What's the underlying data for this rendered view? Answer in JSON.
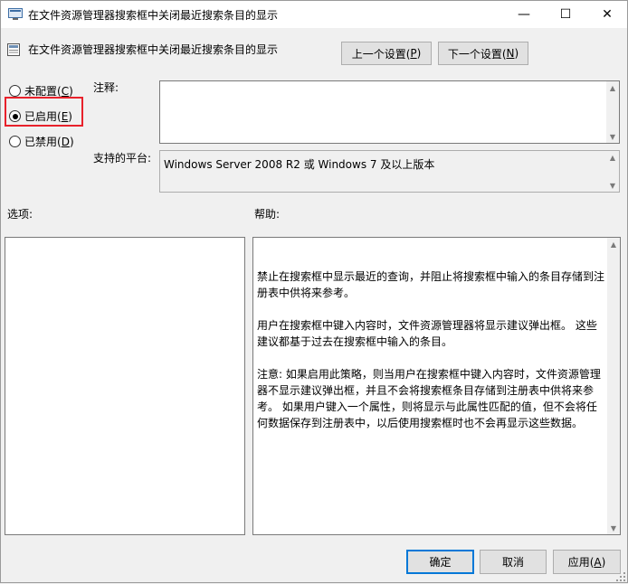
{
  "window": {
    "title": "在文件资源管理器搜索框中关闭最近搜索条目的显示",
    "minimize_glyph": "—",
    "maximize_glyph": "☐",
    "close_glyph": "✕"
  },
  "header": {
    "policy_name": "在文件资源管理器搜索框中关闭最近搜索条目的显示",
    "prev_button": {
      "text": "上一个设置(",
      "key": "P",
      "end": ")"
    },
    "next_button": {
      "text": "下一个设置(",
      "key": "N",
      "end": ")"
    }
  },
  "state": {
    "options": [
      {
        "text": "未配置(",
        "key": "C",
        "end": ")",
        "checked": false
      },
      {
        "text": "已启用(",
        "key": "E",
        "end": ")",
        "checked": true
      },
      {
        "text": "已禁用(",
        "key": "D",
        "end": ")",
        "checked": false
      }
    ]
  },
  "comment": {
    "label": "注释:",
    "value": ""
  },
  "platform": {
    "label": "支持的平台:",
    "value": "Windows Server 2008 R2 或 Windows 7 及以上版本"
  },
  "options_section": {
    "label": "选项:"
  },
  "help_section": {
    "label": "帮助:",
    "paragraphs": [
      "禁止在搜索框中显示最近的查询，并阻止将搜索框中输入的条目存储到注册表中供将来参考。",
      "用户在搜索框中键入内容时，文件资源管理器将显示建议弹出框。 这些建议都基于过去在搜索框中输入的条目。",
      "注意: 如果启用此策略，则当用户在搜索框中键入内容时，文件资源管理器不显示建议弹出框，并且不会将搜索框条目存储到注册表中供将来参考。 如果用户键入一个属性，则将显示与此属性匹配的值，但不会将任何数据保存到注册表中，以后使用搜索框时也不会再显示这些数据。"
    ]
  },
  "footer": {
    "ok": "确定",
    "cancel": "取消",
    "apply": {
      "text": "应用(",
      "key": "A",
      "end": ")"
    }
  },
  "colors": {
    "highlight_border": "#e8212b",
    "default_button_border": "#0078d7",
    "window_bg": "#f0f0f0"
  }
}
